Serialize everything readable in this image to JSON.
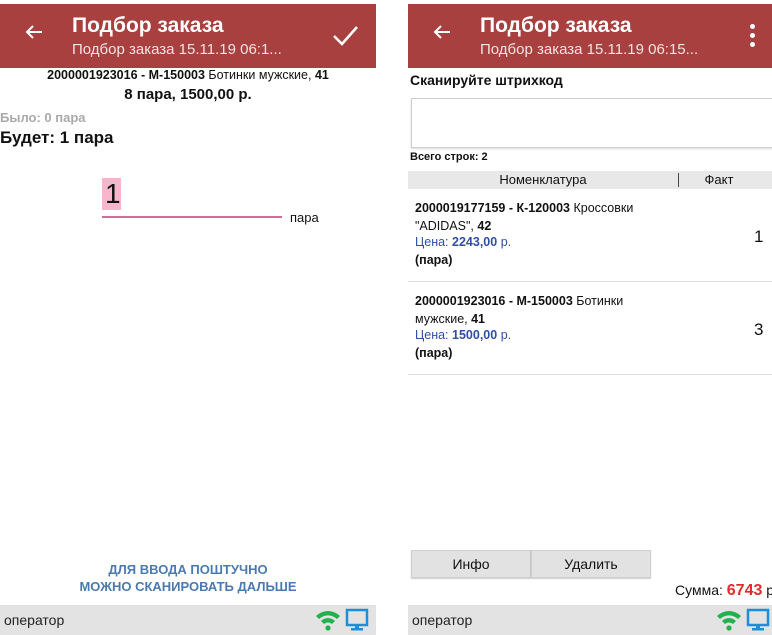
{
  "screen1": {
    "header": {
      "title": "Подбор заказа",
      "subtitle": "Подбор заказа 15.11.19 06:1..."
    },
    "item": {
      "code": "2000001923016 - М-150003",
      "name": "Ботинки мужские,",
      "size": "41"
    },
    "qty_price": "8 пара, 1500,00 р.",
    "was": "Было: 0 пара",
    "will": "Будет: 1 пара",
    "quantity_value": "1",
    "unit": "пара",
    "hint_line1": "ДЛЯ ВВОДА ПОШТУЧНО",
    "hint_line2": "МОЖНО СКАНИРОВАТЬ ДАЛЬШЕ",
    "operator": "оператор"
  },
  "screen2": {
    "header": {
      "title": "Подбор заказа",
      "subtitle": "Подбор заказа 15.11.19 06:15..."
    },
    "scan_label": "Сканируйте штрихкод",
    "scan_value": "",
    "total_rows": "Всего строк: 2",
    "columns": [
      "Номенклатура",
      "Факт"
    ],
    "rows": [
      {
        "code": "2000019177159 - К-120003",
        "name_a": "Кроссовки",
        "name_b": "\"ADIDAS\",",
        "size": "42",
        "price_label": "Цена:",
        "price": "2243,00",
        "price_suffix": "р.",
        "unit": "(пара)",
        "fact": "1"
      },
      {
        "code": "2000001923016 - М-150003",
        "name_a": "Ботинки",
        "name_b": "мужские,",
        "size": "41",
        "price_label": "Цена:",
        "price": "1500,00",
        "price_suffix": "р.",
        "unit": "(пара)",
        "fact": "3"
      }
    ],
    "buttons": {
      "info": "Инфо",
      "delete": "Удалить"
    },
    "sum_label": "Сумма:",
    "sum_value": "6743",
    "sum_suffix": "р",
    "operator": "оператор"
  },
  "colors": {
    "appbar": "#a8403f",
    "accent_pink": "#d66a94",
    "hint_blue": "#4b7ab0",
    "price_blue": "#2f4fa6",
    "sum_red": "#e32a2a",
    "wifi_green": "#22b14c",
    "monitor_blue": "#1d8fd8"
  },
  "icons": {
    "back": "arrow-left-icon",
    "confirm": "check-icon",
    "menu": "more-vert-icon",
    "wifi": "wifi-icon",
    "monitor": "monitor-icon"
  }
}
